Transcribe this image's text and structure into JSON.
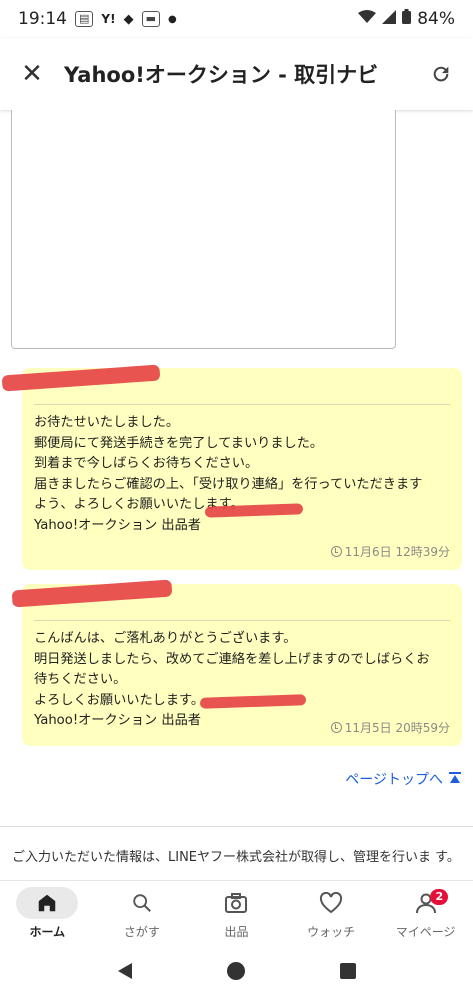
{
  "status_bar": {
    "time": "19:14",
    "icons": [
      "news-icon",
      "yahoo-icon",
      "game-icon",
      "app-icon",
      "dot-icon"
    ],
    "battery": "84%"
  },
  "app_bar": {
    "close_icon": "close-icon",
    "title": "Yahoo!オークション - 取引ナビ",
    "reload_icon": "reload-icon"
  },
  "messages": [
    {
      "body": "お待たせいたしました。\n郵便局にて発送手続きを完了してまいりました。\n到着まで今しばらくお待ちください。\n届きましたらご確認の上、「受け取り連絡」を行っていただきます\nよう、よろしくお願いいたします。\nYahoo!オークション 出品者",
      "time": "11月6日 12時39分"
    },
    {
      "body": "こんばんは、ご落札ありがとうございます。\n明日発送しましたら、改めてご連絡を差し上げますのでしばらくお\n待ちください。\nよろしくお願いいたします。\nYahoo!オークション 出品者",
      "time": "11月5日 20時59分"
    }
  ],
  "page_top": {
    "label": "ページトップへ"
  },
  "notice": "ご入力いただいた情報は、LINEヤフー株式会社が取得し、管理を行いま す。",
  "tab_bar": {
    "tabs": [
      {
        "label": "ホーム",
        "icon": "home-icon",
        "active": true
      },
      {
        "label": "さがす",
        "icon": "search-icon",
        "active": false
      },
      {
        "label": "出品",
        "icon": "camera-icon",
        "active": false
      },
      {
        "label": "ウォッチ",
        "icon": "heart-icon",
        "active": false
      },
      {
        "label": "マイページ",
        "icon": "person-icon",
        "active": false,
        "badge": "2"
      }
    ]
  },
  "nav_bar": {
    "icons": [
      "back-icon",
      "home-circle-icon",
      "recents-icon"
    ]
  },
  "colors": {
    "message_bg": "#ffffbf",
    "link": "#1c5fd8",
    "badge": "#e5103a",
    "redaction": "#e64545"
  }
}
